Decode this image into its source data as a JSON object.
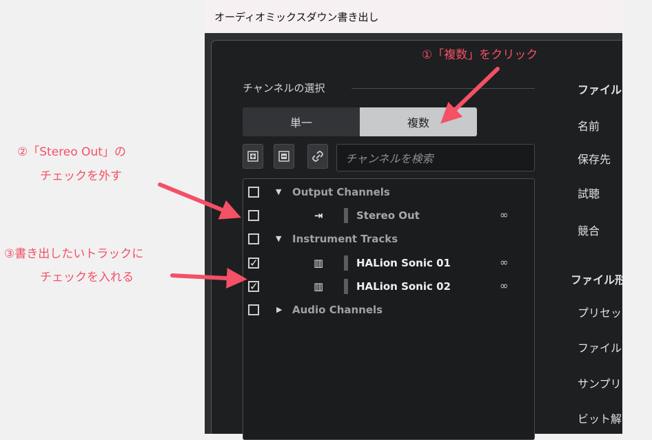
{
  "window": {
    "title": "オーディオミックスダウン書き出し"
  },
  "channel_section": {
    "title": "チャンネルの選択",
    "mode_single": "単一",
    "mode_multiple": "複数",
    "selected_mode": "複数",
    "search_placeholder": "チャンネルを検索"
  },
  "tree": {
    "output_group": "Output Channels",
    "stereo_out": "Stereo Out",
    "instrument_group": "Instrument Tracks",
    "track1": "HALion Sonic 01",
    "track2": "HALion Sonic 02",
    "audio_group": "Audio Channels"
  },
  "right_panel": {
    "file_section": "ファイルの",
    "name": "名前",
    "location": "保存先",
    "audition": "試聴",
    "conflict": "競合",
    "format_section": "ファイル形",
    "preset": "プリセッ",
    "file": "ファイル",
    "sample": "サンプリ",
    "bit": "ビット解"
  },
  "annotations": {
    "a1": "①「複数」をクリック",
    "a2_l1": "②「Stereo Out」の",
    "a2_l2": "チェックを外す",
    "a3_l1": "③書き出したいトラックに",
    "a3_l2": "チェックを入れる"
  },
  "colors": {
    "annotation": "#f45066",
    "accent_selected": "#c7c9cb"
  },
  "checkboxes": {
    "output_channels": false,
    "stereo_out": false,
    "instrument_tracks": false,
    "halion_sonic_01": true,
    "halion_sonic_02": true,
    "audio_channels": false
  }
}
